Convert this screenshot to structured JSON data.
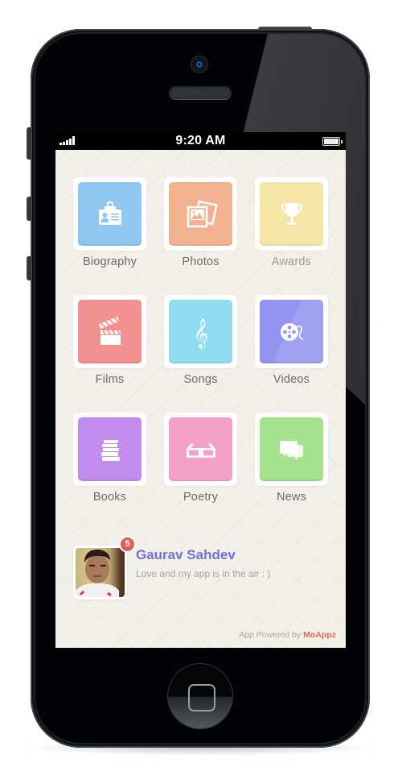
{
  "statusbar": {
    "time": "9:20 AM",
    "signal_icon": "signal-bars-icon",
    "battery_icon": "battery-icon"
  },
  "colors": {
    "background": "#f3f0e9",
    "accent_name": "#6d72d6",
    "badge": "#e55a5a",
    "brand": "#e5694d"
  },
  "tiles": [
    {
      "label": "Biography",
      "icon": "id-badge-icon",
      "color": "#8fc7f0"
    },
    {
      "label": "Photos",
      "icon": "photos-icon",
      "color": "#f2b28f"
    },
    {
      "label": "Awards",
      "icon": "trophy-icon",
      "color": "#f5e6a8"
    },
    {
      "label": "Films",
      "icon": "clapperboard-icon",
      "color": "#f09090"
    },
    {
      "label": "Songs",
      "icon": "treble-clef-icon",
      "color": "#8fdbf0"
    },
    {
      "label": "Videos",
      "icon": "film-reel-icon",
      "color": "#9294ef"
    },
    {
      "label": "Books",
      "icon": "books-stack-icon",
      "color": "#c28cef"
    },
    {
      "label": "Poetry",
      "icon": "glasses-icon",
      "color": "#f5a0c8"
    },
    {
      "label": "News",
      "icon": "chat-bubbles-icon",
      "color": "#a5e28e"
    }
  ],
  "profile": {
    "name": "Gaurav Sahdev",
    "status": "Love and my app is in the air : )",
    "notification_count": "5"
  },
  "footer": {
    "prefix": "App Powered by ",
    "brand": "MoAppz"
  }
}
